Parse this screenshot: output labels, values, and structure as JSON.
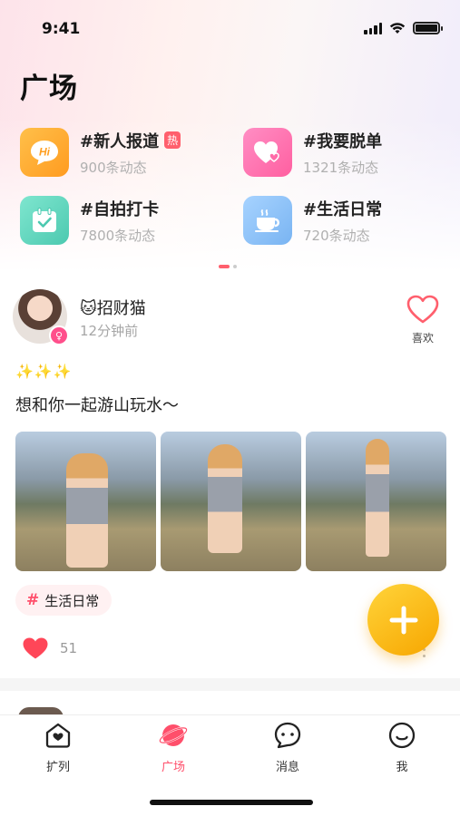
{
  "status_bar": {
    "time": "9:41"
  },
  "page": {
    "title": "广场"
  },
  "topics": [
    {
      "name": "#新人报道",
      "count": "900条动态",
      "badge": "热",
      "icon": "hi-bubble-icon",
      "color": "#ffa72b"
    },
    {
      "name": "#我要脱单",
      "count": "1321条动态",
      "icon": "hearts-icon",
      "color": "#ff6fae"
    },
    {
      "name": "#自拍打卡",
      "count": "7800条动态",
      "icon": "calendar-check-icon",
      "color": "#5fd6bf"
    },
    {
      "name": "#生活日常",
      "count": "720条动态",
      "icon": "coffee-cup-icon",
      "color": "#7fb8f5"
    }
  ],
  "post": {
    "username": "🐱招财猫",
    "time": "12分钟前",
    "like_label": "喜欢",
    "sparkles": "✨✨✨",
    "text": "想和你一起游山玩水～",
    "tag": "生活日常",
    "likes": "51",
    "photos": [
      "photo-1",
      "photo-2",
      "photo-3"
    ]
  },
  "tabbar": {
    "items": [
      {
        "label": "扩列",
        "icon": "home-heart-icon"
      },
      {
        "label": "广场",
        "icon": "planet-icon",
        "active": true
      },
      {
        "label": "消息",
        "icon": "chat-bubble-icon"
      },
      {
        "label": "我",
        "icon": "smile-face-icon"
      }
    ]
  },
  "colors": {
    "accent": "#ff4f6b",
    "fab": "#fbbf1a"
  }
}
